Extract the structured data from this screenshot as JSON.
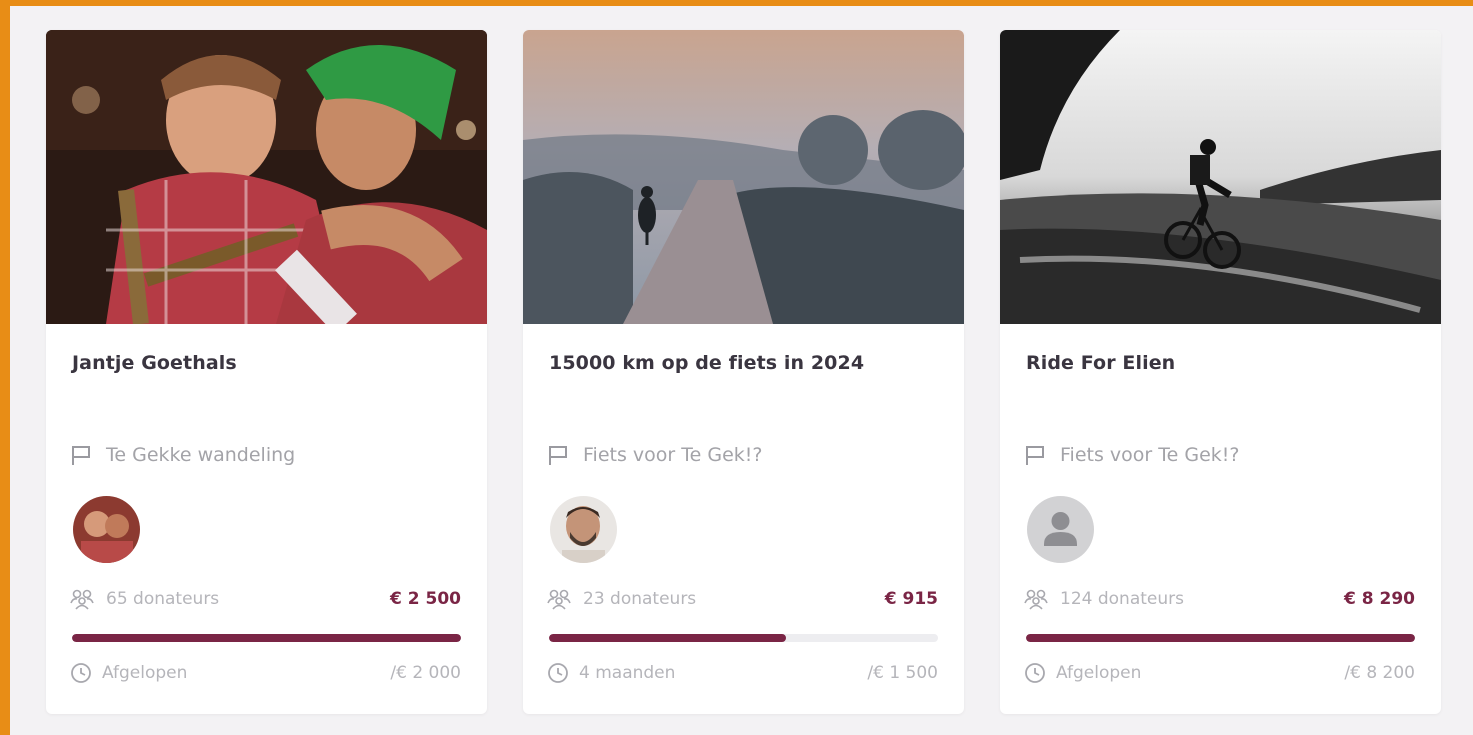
{
  "cards": [
    {
      "name": "Jantje Goethals",
      "campaign": "Te Gekke wandeling",
      "donors": "65 donateurs",
      "amount": "€ 2 500",
      "progress": 1.0,
      "time_left": "Afgelopen",
      "goal": "/€ 2 000",
      "campaign_icon": "flag-icon",
      "donors_icon": "people-icon",
      "time_icon": "clock-icon"
    },
    {
      "name": "15000 km op de fiets in 2024",
      "campaign": "Fiets voor Te Gek!?",
      "donors": "23 donateurs",
      "amount": "€ 915",
      "progress": 0.61,
      "time_left": "4 maanden",
      "goal": "/€ 1 500",
      "campaign_icon": "flag-icon",
      "donors_icon": "people-icon",
      "time_icon": "clock-icon"
    },
    {
      "name": "Ride For Elien",
      "campaign": "Fiets voor Te Gek!?",
      "donors": "124 donateurs",
      "amount": "€ 8 290",
      "progress": 1.0,
      "time_left": "Afgelopen",
      "goal": "/€ 8 200",
      "campaign_icon": "flag-icon",
      "donors_icon": "people-icon",
      "time_icon": "clock-icon"
    }
  ],
  "colors": {
    "accent": "#7a2545",
    "frame": "#e88d16",
    "background": "#f3f2f4",
    "muted_text": "#a3a3a8"
  }
}
